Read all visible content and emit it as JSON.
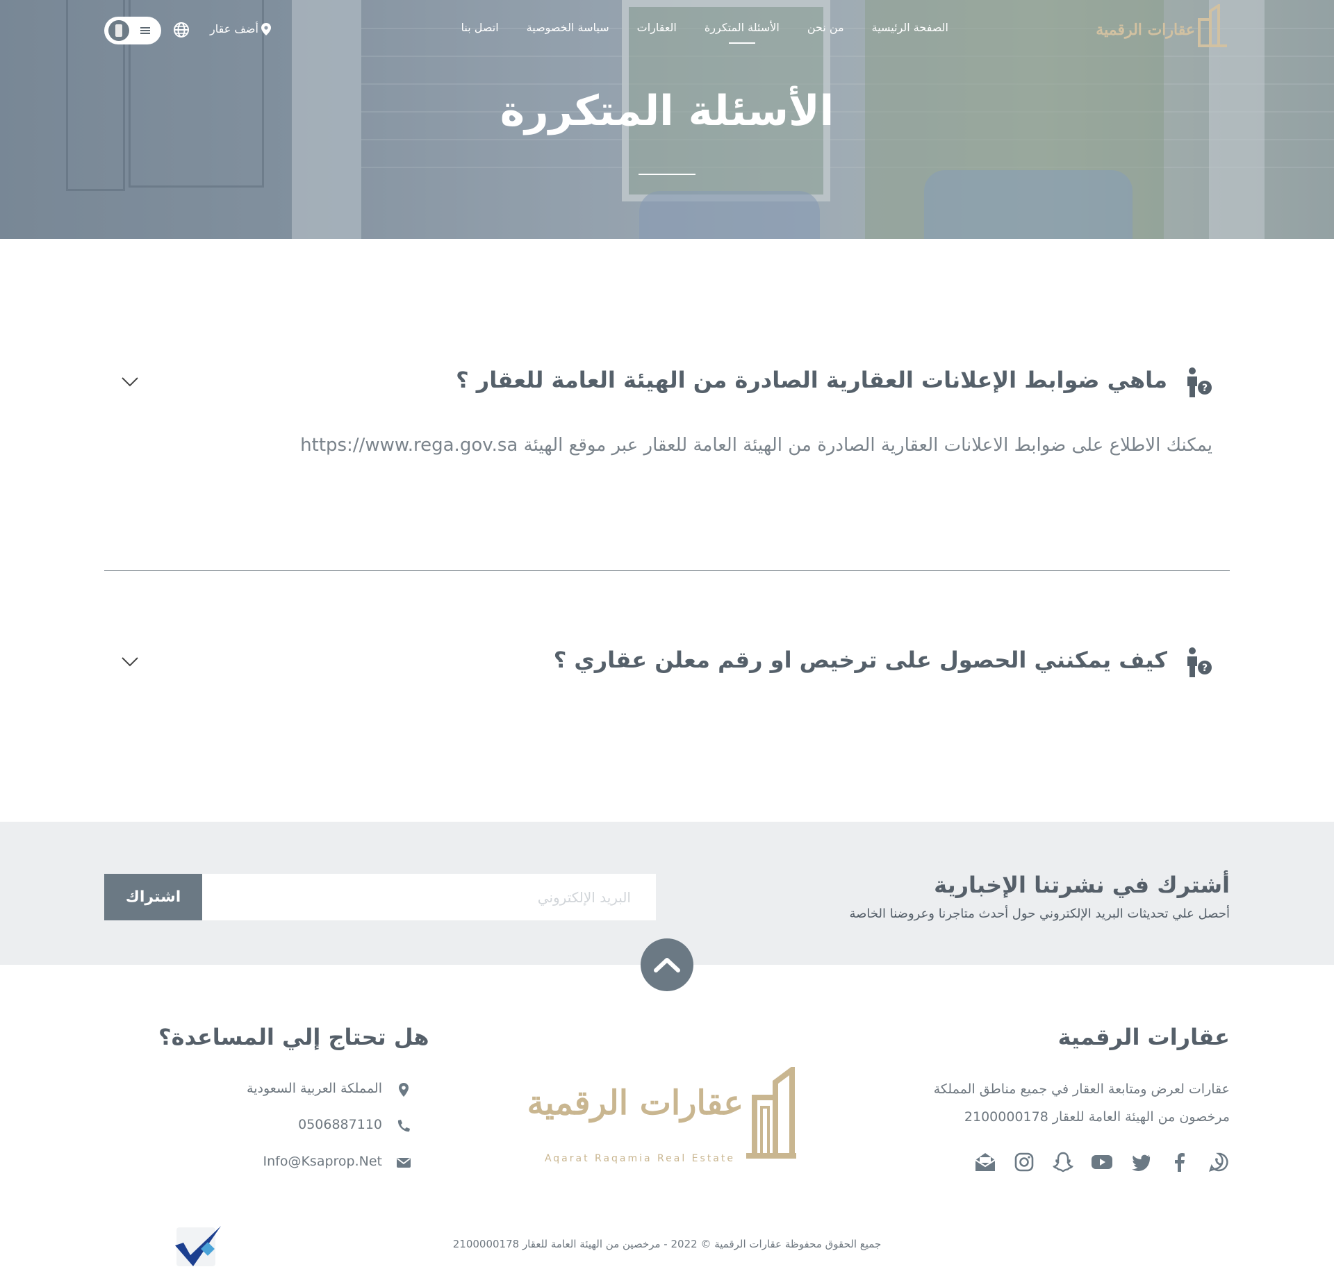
{
  "nav": {
    "brand": "عقارات الرقمية",
    "menu": [
      {
        "label": "الصفحة الرئيسية",
        "active": false
      },
      {
        "label": "من نحن",
        "active": false
      },
      {
        "label": "الأسئلة المتكررة",
        "active": true
      },
      {
        "label": "العقارات",
        "active": false
      },
      {
        "label": "سياسة الخصوصية",
        "active": false
      },
      {
        "label": "اتصل بنا",
        "active": false
      }
    ],
    "add_property": "أضف عقار"
  },
  "hero": {
    "title": "الأسئلة المتكررة"
  },
  "faq": [
    {
      "question": "ماهي ضوابط الإعلانات العقارية الصادرة من الهيئة العامة للعقار ؟",
      "answer": "يمكنك الاطلاع على ضوابط الاعلانات العقارية الصادرة من الهيئة العامة للعقار عبر موقع الهيئة https://www.rega.gov.sa",
      "expanded": true
    },
    {
      "question": "كيف يمكنني الحصول على ترخيص او رقم معلن عقاري ؟",
      "answer": "",
      "expanded": false
    }
  ],
  "newsletter": {
    "title": "أشترك في نشرتنا الإخبارية",
    "subtitle": "أحصل علي تحديثات البريد الإلكتروني حول أحدث متاجرنا وعروضنا الخاصة",
    "placeholder": "البريد الإلكتروني",
    "button": "اشتراك"
  },
  "footer": {
    "about_title": "عقارات الرقمية",
    "about_line1": "عقارات لعرض ومتابعة العقار في جميع مناطق المملكة",
    "about_line2": "مرخصون من الهيئة العامة للعقار 2100000178",
    "logo_name": "عقارات الرقمية",
    "logo_en": "Aqarat Raqamia Real Estate",
    "help_title": "هل تحتاج إلي المساعدة؟",
    "address": "المملكة العربية السعودية",
    "phone": "0506887110",
    "email": "Info@Ksaprop.Net",
    "copyright": "جميع الحقوق محفوظة عقارات الرقمية © 2022 - مرخصين من الهيئة العامة للعقار 2100000178",
    "social_icons": [
      "whatsapp-icon",
      "facebook-icon",
      "twitter-icon",
      "youtube-icon",
      "snapchat-icon",
      "instagram-icon",
      "email-open-icon"
    ]
  },
  "colors": {
    "accent": "#6b7984",
    "gold": "#c9b690",
    "heading": "#55606a",
    "newsletter_bg": "#eceef0"
  }
}
